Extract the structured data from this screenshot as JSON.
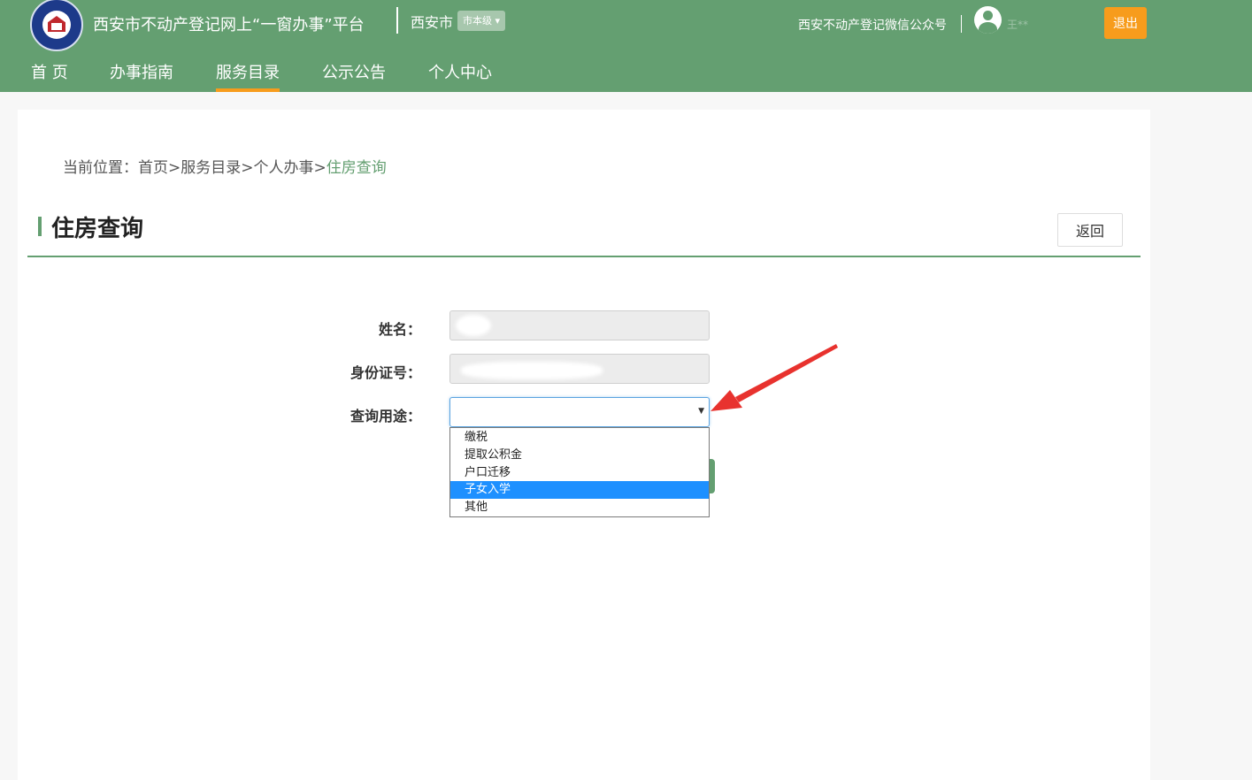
{
  "header": {
    "site_title": "西安市不动产登记网上“一窗办事”平台",
    "city": "西安市",
    "city_level": "市本级 ▾",
    "wechat": "西安不动产登记微信公众号",
    "username": "王**",
    "logout": "退出"
  },
  "nav": [
    {
      "label": "首 页"
    },
    {
      "label": "办事指南"
    },
    {
      "label": "服务目录"
    },
    {
      "label": "公示公告"
    },
    {
      "label": "个人中心"
    }
  ],
  "breadcrumb": {
    "prefix": "当前位置：首页>服务目录>个人办事>",
    "current": "住房查询"
  },
  "page": {
    "title": "住房查询",
    "back": "返回"
  },
  "form": {
    "name_label": "姓名：",
    "id_label": "身份证号：",
    "purpose_label": "查询用途：",
    "purpose_value": "",
    "options": [
      "缴税",
      "提取公积金",
      "户口迁移",
      "子女入学",
      "其他"
    ],
    "highlighted_option": "子女入学"
  },
  "colors": {
    "brand_green": "#649f71",
    "accent_orange": "#f79c1c",
    "select_highlight": "#1e90ff",
    "annotation_red": "#e8322e"
  }
}
